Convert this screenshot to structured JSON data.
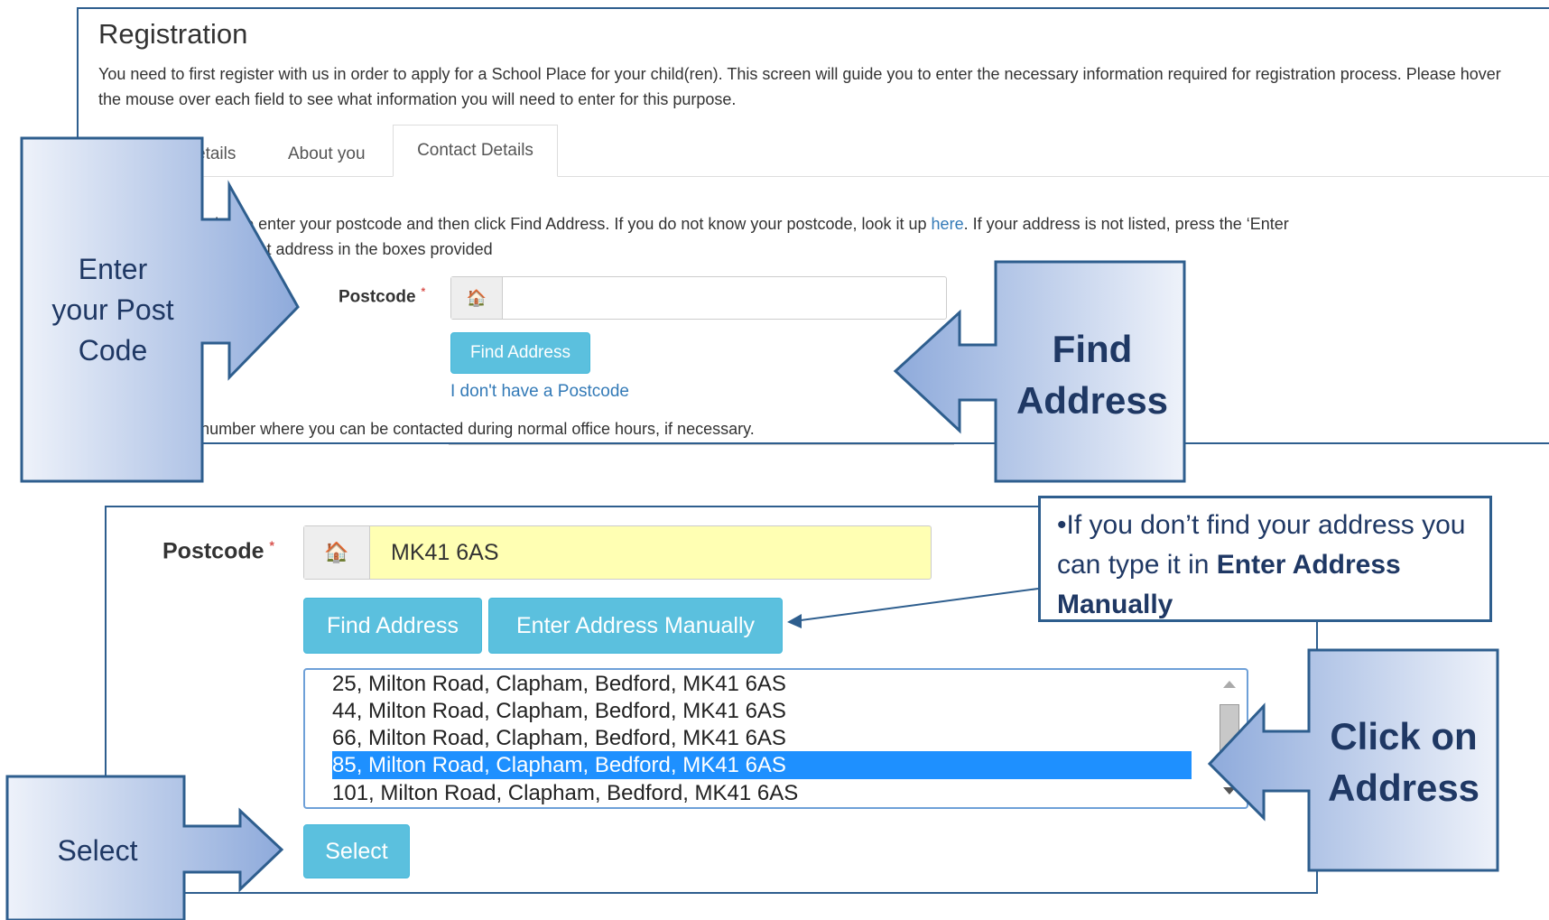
{
  "top_panel": {
    "title": "Registration",
    "intro": "You need to first register with us in order to apply for a School Place for your child(ren). This screen will guide you to enter the necessary information required for registration process. Please hover the mouse over each field to see what information you will need to enter for this purpose.",
    "tabs": [
      {
        "label": "etails"
      },
      {
        "label": "About you"
      },
      {
        "label": "Contact Details",
        "active": true
      }
    ],
    "help_text_before_link": "home address please enter your postcode and then click Find Address. If you do not know your postcode, look it up ",
    "help_link": "here",
    "help_text_after_link": ". If your address is not listed, press the ‘Enter",
    "help_text_line2": "ual’ and type the correct address in the boxes provided",
    "postcode_label": "Postcode",
    "required_mark": "*",
    "postcode_icon": "home-icon",
    "postcode_value": "",
    "find_address_label": "Find Address",
    "no_postcode_link": "I don't have a Postcode",
    "telephone_text": "y a telephone number where you can be contacted during normal office hours, if necessary."
  },
  "bottom_panel": {
    "postcode_label": "Postcode",
    "required_mark": "*",
    "postcode_icon": "home-icon",
    "postcode_value": "MK41 6AS",
    "find_address_label": "Find Address",
    "enter_manually_label": "Enter Address Manually",
    "addresses": [
      "25, Milton Road, Clapham, Bedford, MK41 6AS",
      "44, Milton Road, Clapham, Bedford, MK41 6AS",
      "66, Milton Road, Clapham, Bedford, MK41 6AS",
      "85, Milton Road, Clapham, Bedford, MK41 6AS",
      "101, Milton Road, Clapham, Bedford, MK41 6AS"
    ],
    "selected_address_index": 3,
    "select_label": "Select"
  },
  "callouts": {
    "enter_postcode_line1": "Enter",
    "enter_postcode_line2": "your Post",
    "enter_postcode_line3": "Code",
    "find_address_line1": "Find",
    "find_address_line2": "Address",
    "click_address_line1": "Click on",
    "click_address_line2": "Address",
    "select": "Select",
    "note_bullet": "•",
    "note_part1": "If you don’t find your address you can type it in ",
    "note_bold": "Enter Address Manually"
  },
  "colors": {
    "accent_button": "#5bc0de",
    "callout_fill_light": "#dbe5f5",
    "callout_fill_dark": "#8eaadb",
    "callout_border": "#2e5e8e",
    "selected_row": "#1e90ff",
    "postcode_highlight": "#ffffb3",
    "link": "#337ab7"
  }
}
